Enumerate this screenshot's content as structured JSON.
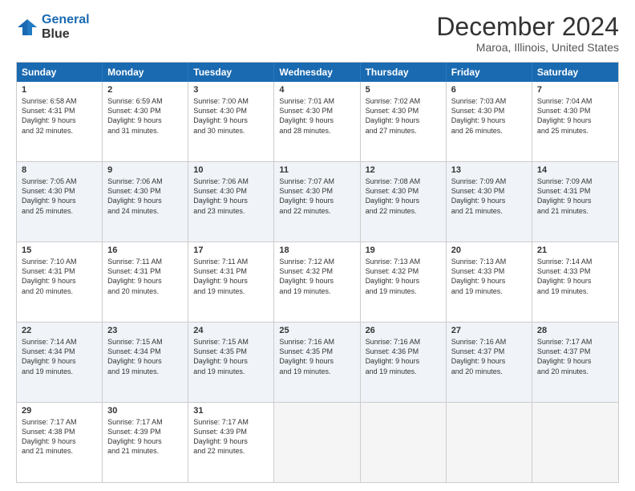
{
  "logo": {
    "line1": "General",
    "line2": "Blue"
  },
  "title": "December 2024",
  "location": "Maroa, Illinois, United States",
  "headers": [
    "Sunday",
    "Monday",
    "Tuesday",
    "Wednesday",
    "Thursday",
    "Friday",
    "Saturday"
  ],
  "weeks": [
    [
      {
        "day": "1",
        "text": "Sunrise: 6:58 AM\nSunset: 4:31 PM\nDaylight: 9 hours\nand 32 minutes."
      },
      {
        "day": "2",
        "text": "Sunrise: 6:59 AM\nSunset: 4:30 PM\nDaylight: 9 hours\nand 31 minutes."
      },
      {
        "day": "3",
        "text": "Sunrise: 7:00 AM\nSunset: 4:30 PM\nDaylight: 9 hours\nand 30 minutes."
      },
      {
        "day": "4",
        "text": "Sunrise: 7:01 AM\nSunset: 4:30 PM\nDaylight: 9 hours\nand 28 minutes."
      },
      {
        "day": "5",
        "text": "Sunrise: 7:02 AM\nSunset: 4:30 PM\nDaylight: 9 hours\nand 27 minutes."
      },
      {
        "day": "6",
        "text": "Sunrise: 7:03 AM\nSunset: 4:30 PM\nDaylight: 9 hours\nand 26 minutes."
      },
      {
        "day": "7",
        "text": "Sunrise: 7:04 AM\nSunset: 4:30 PM\nDaylight: 9 hours\nand 25 minutes."
      }
    ],
    [
      {
        "day": "8",
        "text": "Sunrise: 7:05 AM\nSunset: 4:30 PM\nDaylight: 9 hours\nand 25 minutes."
      },
      {
        "day": "9",
        "text": "Sunrise: 7:06 AM\nSunset: 4:30 PM\nDaylight: 9 hours\nand 24 minutes."
      },
      {
        "day": "10",
        "text": "Sunrise: 7:06 AM\nSunset: 4:30 PM\nDaylight: 9 hours\nand 23 minutes."
      },
      {
        "day": "11",
        "text": "Sunrise: 7:07 AM\nSunset: 4:30 PM\nDaylight: 9 hours\nand 22 minutes."
      },
      {
        "day": "12",
        "text": "Sunrise: 7:08 AM\nSunset: 4:30 PM\nDaylight: 9 hours\nand 22 minutes."
      },
      {
        "day": "13",
        "text": "Sunrise: 7:09 AM\nSunset: 4:30 PM\nDaylight: 9 hours\nand 21 minutes."
      },
      {
        "day": "14",
        "text": "Sunrise: 7:09 AM\nSunset: 4:31 PM\nDaylight: 9 hours\nand 21 minutes."
      }
    ],
    [
      {
        "day": "15",
        "text": "Sunrise: 7:10 AM\nSunset: 4:31 PM\nDaylight: 9 hours\nand 20 minutes."
      },
      {
        "day": "16",
        "text": "Sunrise: 7:11 AM\nSunset: 4:31 PM\nDaylight: 9 hours\nand 20 minutes."
      },
      {
        "day": "17",
        "text": "Sunrise: 7:11 AM\nSunset: 4:31 PM\nDaylight: 9 hours\nand 19 minutes."
      },
      {
        "day": "18",
        "text": "Sunrise: 7:12 AM\nSunset: 4:32 PM\nDaylight: 9 hours\nand 19 minutes."
      },
      {
        "day": "19",
        "text": "Sunrise: 7:13 AM\nSunset: 4:32 PM\nDaylight: 9 hours\nand 19 minutes."
      },
      {
        "day": "20",
        "text": "Sunrise: 7:13 AM\nSunset: 4:33 PM\nDaylight: 9 hours\nand 19 minutes."
      },
      {
        "day": "21",
        "text": "Sunrise: 7:14 AM\nSunset: 4:33 PM\nDaylight: 9 hours\nand 19 minutes."
      }
    ],
    [
      {
        "day": "22",
        "text": "Sunrise: 7:14 AM\nSunset: 4:34 PM\nDaylight: 9 hours\nand 19 minutes."
      },
      {
        "day": "23",
        "text": "Sunrise: 7:15 AM\nSunset: 4:34 PM\nDaylight: 9 hours\nand 19 minutes."
      },
      {
        "day": "24",
        "text": "Sunrise: 7:15 AM\nSunset: 4:35 PM\nDaylight: 9 hours\nand 19 minutes."
      },
      {
        "day": "25",
        "text": "Sunrise: 7:16 AM\nSunset: 4:35 PM\nDaylight: 9 hours\nand 19 minutes."
      },
      {
        "day": "26",
        "text": "Sunrise: 7:16 AM\nSunset: 4:36 PM\nDaylight: 9 hours\nand 19 minutes."
      },
      {
        "day": "27",
        "text": "Sunrise: 7:16 AM\nSunset: 4:37 PM\nDaylight: 9 hours\nand 20 minutes."
      },
      {
        "day": "28",
        "text": "Sunrise: 7:17 AM\nSunset: 4:37 PM\nDaylight: 9 hours\nand 20 minutes."
      }
    ],
    [
      {
        "day": "29",
        "text": "Sunrise: 7:17 AM\nSunset: 4:38 PM\nDaylight: 9 hours\nand 21 minutes."
      },
      {
        "day": "30",
        "text": "Sunrise: 7:17 AM\nSunset: 4:39 PM\nDaylight: 9 hours\nand 21 minutes."
      },
      {
        "day": "31",
        "text": "Sunrise: 7:17 AM\nSunset: 4:39 PM\nDaylight: 9 hours\nand 22 minutes."
      },
      {
        "day": "",
        "text": ""
      },
      {
        "day": "",
        "text": ""
      },
      {
        "day": "",
        "text": ""
      },
      {
        "day": "",
        "text": ""
      }
    ]
  ]
}
